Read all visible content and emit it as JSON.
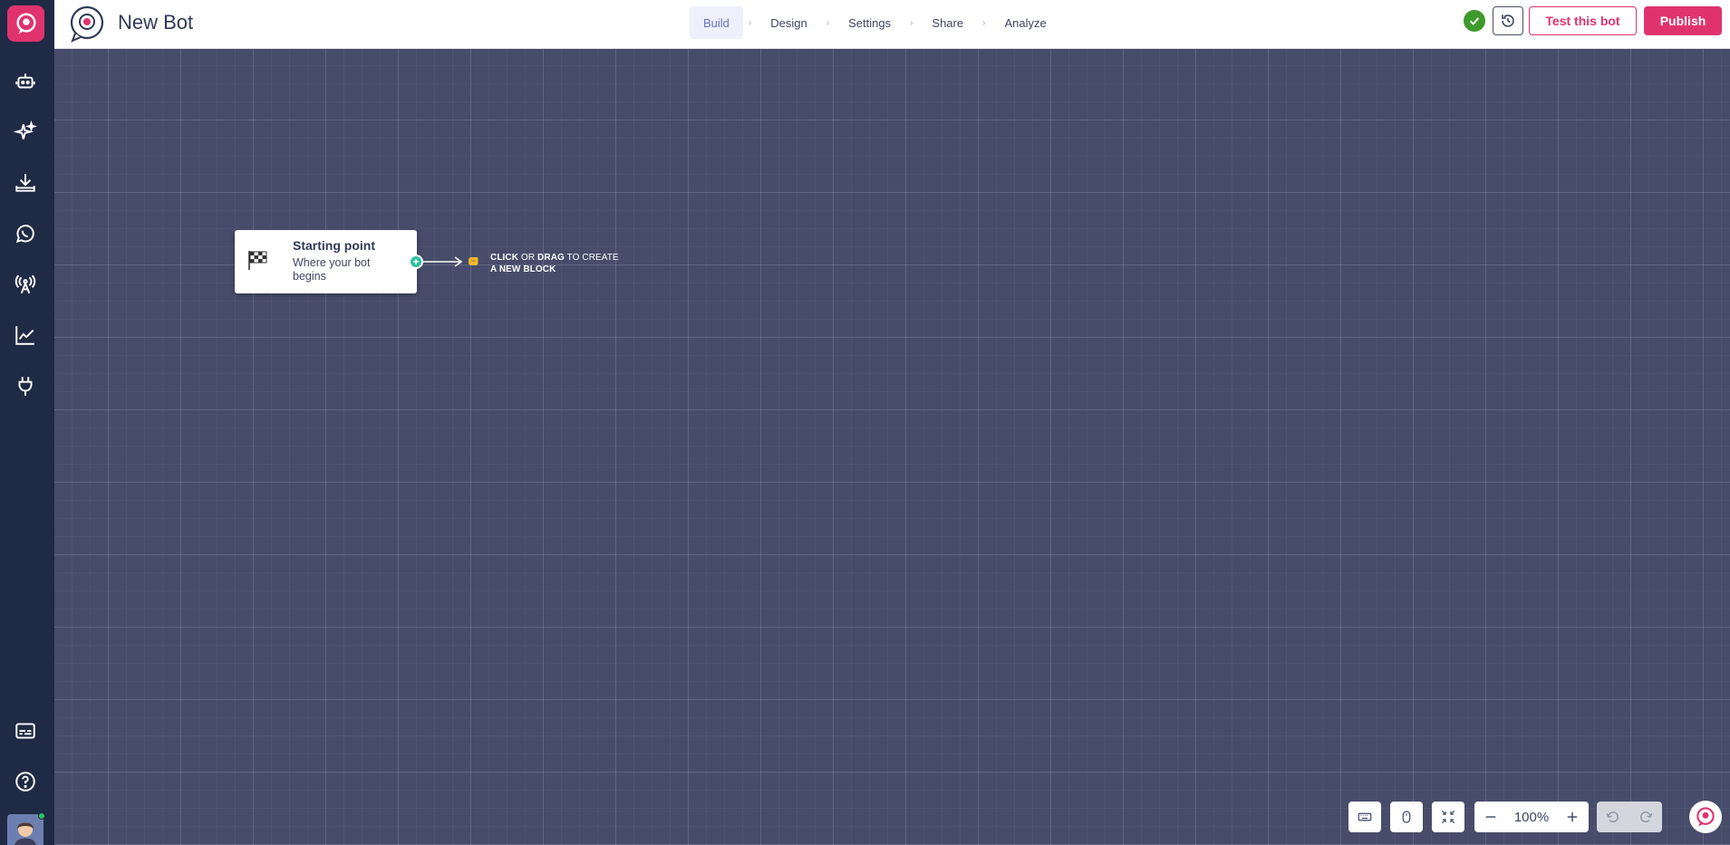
{
  "app": {
    "bot_name": "New Bot"
  },
  "steps": [
    {
      "label": "Build",
      "active": true
    },
    {
      "label": "Design",
      "active": false
    },
    {
      "label": "Settings",
      "active": false
    },
    {
      "label": "Share",
      "active": false
    },
    {
      "label": "Analyze",
      "active": false
    }
  ],
  "header": {
    "test_label": "Test this bot",
    "publish_label": "Publish"
  },
  "sidebar": {
    "items": [
      {
        "icon": "bot-icon"
      },
      {
        "icon": "sparkles-icon"
      },
      {
        "icon": "download-icon"
      },
      {
        "icon": "whatsapp-icon"
      },
      {
        "icon": "broadcast-icon"
      },
      {
        "icon": "chart-icon"
      },
      {
        "icon": "plug-icon"
      }
    ],
    "bottom": [
      {
        "icon": "subtitles-icon"
      },
      {
        "icon": "help-icon"
      }
    ]
  },
  "canvas": {
    "start_node": {
      "title": "Starting point",
      "subtitle": "Where your bot begins"
    },
    "hint": {
      "click": "CLICK",
      "or": "OR",
      "drag": "DRAG",
      "to_create": "TO CREATE",
      "new_block": "A NEW BLOCK"
    }
  },
  "controls": {
    "zoom": "100%"
  },
  "colors": {
    "brand": "#e0336e",
    "sidebar": "#1f2a44",
    "canvas": "#474c6a",
    "connector": "#2fbf9f",
    "status_ok": "#3f9a2c"
  }
}
